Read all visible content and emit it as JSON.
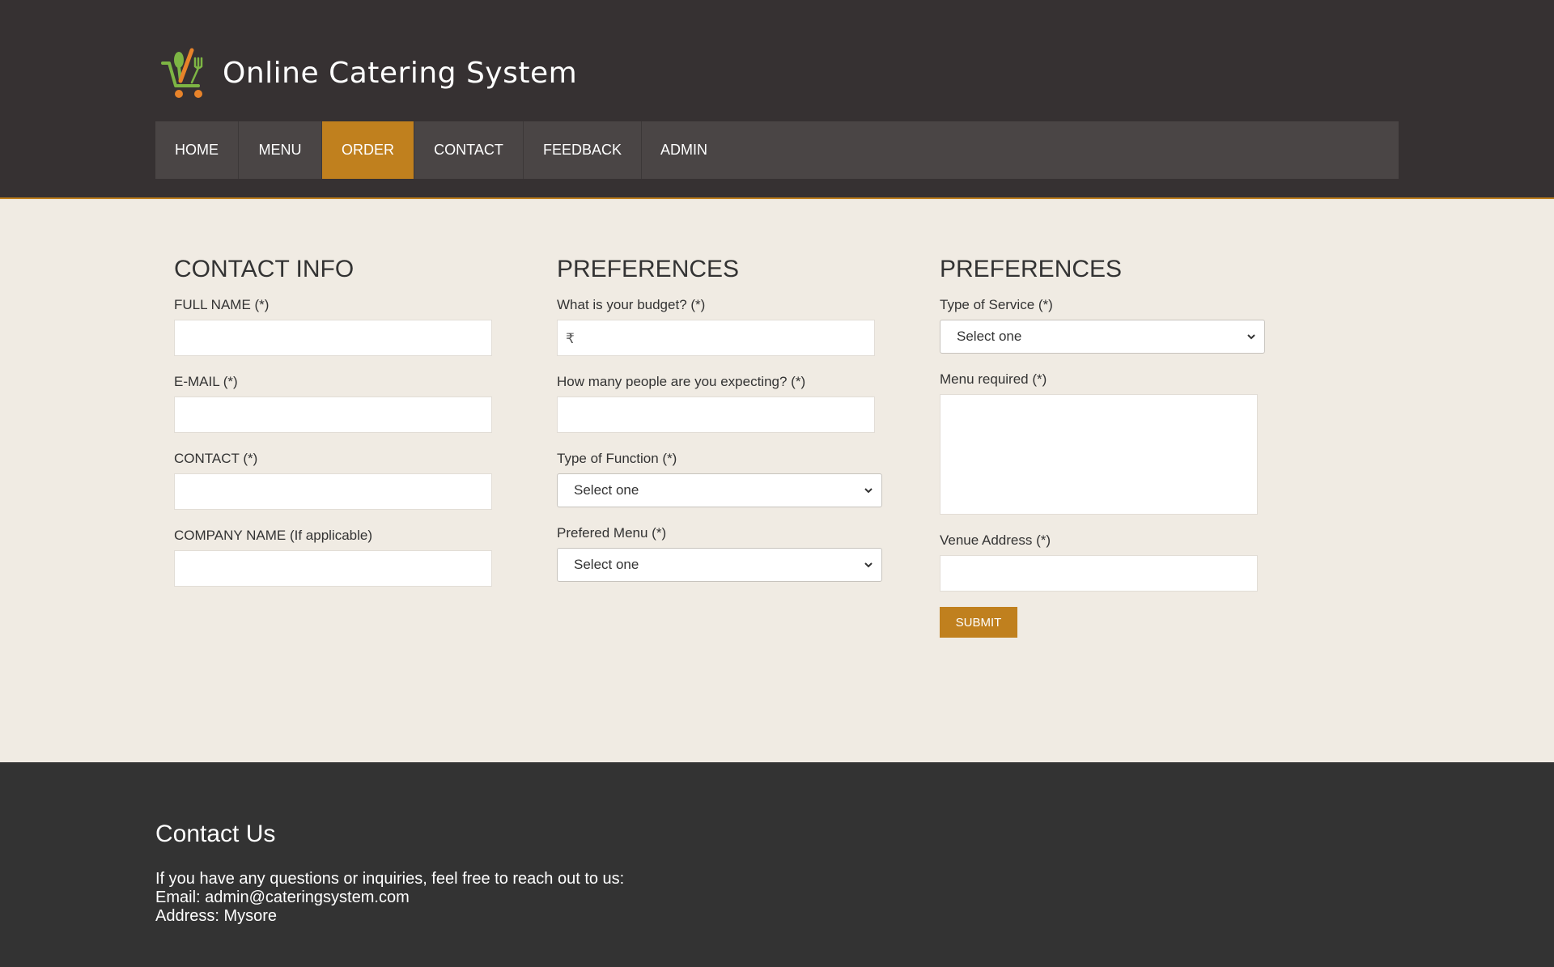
{
  "site": {
    "title": "Online Catering System"
  },
  "nav": {
    "items": [
      {
        "label": "HOME",
        "active": false
      },
      {
        "label": "MENU",
        "active": false
      },
      {
        "label": "ORDER",
        "active": true
      },
      {
        "label": "CONTACT",
        "active": false
      },
      {
        "label": "FEEDBACK",
        "active": false
      },
      {
        "label": "ADMIN",
        "active": false
      }
    ]
  },
  "form": {
    "contact": {
      "heading": "CONTACT INFO",
      "full_name_label": "FULL NAME (*)",
      "email_label": "E-MAIL (*)",
      "contact_label": "CONTACT (*)",
      "company_label": "COMPANY NAME (If applicable)"
    },
    "preferences1": {
      "heading": "PREFERENCES",
      "budget_label": "What is your budget? (*)",
      "budget_prefix": "₹",
      "people_label": "How many people are you expecting? (*)",
      "function_label": "Type of Function (*)",
      "function_value": "Select one",
      "menu_label": "Prefered Menu (*)",
      "menu_value": "Select one"
    },
    "preferences2": {
      "heading": "PREFERENCES",
      "service_label": "Type of Service (*)",
      "service_value": "Select one",
      "menu_required_label": "Menu required (*)",
      "venue_label": "Venue Address (*)",
      "submit_label": "SUBMIT"
    }
  },
  "footer": {
    "heading": "Contact Us",
    "intro": "If you have any questions or inquiries, feel free to reach out to us:",
    "email": "Email: admin@cateringsystem.com",
    "address": "Address: Mysore"
  },
  "colors": {
    "header_bg": "#363132",
    "nav_bg": "#4a4545",
    "accent": "#c0801e",
    "page_bg": "#f0ebe3",
    "footer_bg": "#333333"
  }
}
